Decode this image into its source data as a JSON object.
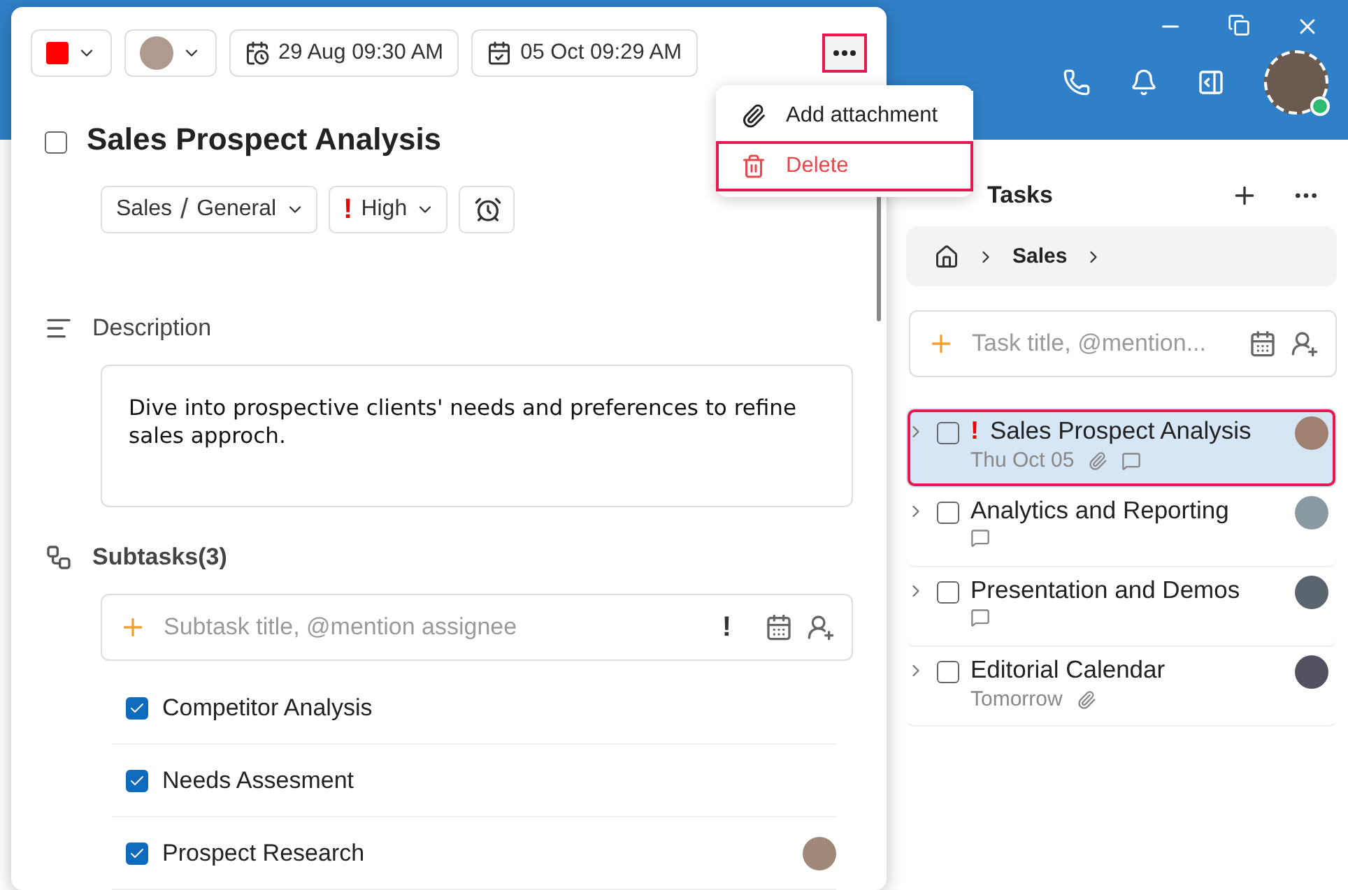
{
  "header": {
    "user_online": true
  },
  "detail": {
    "color": "#ff0000",
    "start": "29 Aug 09:30 AM",
    "due": "05 Oct 09:29 AM",
    "more_highlighted": true,
    "title": "Sales Prospect Analysis",
    "completed": false,
    "path": [
      "Sales",
      "General"
    ],
    "path_separator": "/",
    "priority_mark": "!",
    "priority": "High",
    "description_label": "Description",
    "description": "Dive into prospective clients' needs and preferences to refine sales approch.",
    "subtasks_label": "Subtasks(3)",
    "subtask_placeholder": "Subtask title, @mention assignee",
    "priority_button": "!",
    "subtasks": [
      {
        "title": "Competitor Analysis",
        "checked": true,
        "assigned": false
      },
      {
        "title": "Needs Assesment",
        "checked": true,
        "assigned": false
      },
      {
        "title": "Prospect Research",
        "checked": true,
        "assigned": true
      }
    ]
  },
  "menu": {
    "items": [
      {
        "kind": "attach",
        "label": "Add attachment",
        "highlighted": false
      },
      {
        "kind": "delete",
        "label": "Delete",
        "highlighted": true
      }
    ]
  },
  "tasks": {
    "title": "Tasks",
    "breadcrumb": [
      "Sales"
    ],
    "placeholder": "Task title, @mention...",
    "items": [
      {
        "title": "Sales Prospect Analysis",
        "priority_mark": "!",
        "due": "Thu Oct 05",
        "attachment": true,
        "comment": true,
        "selected": true,
        "completed": false
      },
      {
        "title": "Analytics and Reporting",
        "attachment": false,
        "comment": true,
        "selected": false,
        "completed": false
      },
      {
        "title": "Presentation and Demos",
        "attachment": false,
        "comment": true,
        "selected": false,
        "completed": false
      },
      {
        "title": "Editorial Calendar",
        "due": "Tomorrow",
        "attachment": true,
        "comment": false,
        "selected": false,
        "completed": false
      }
    ]
  }
}
